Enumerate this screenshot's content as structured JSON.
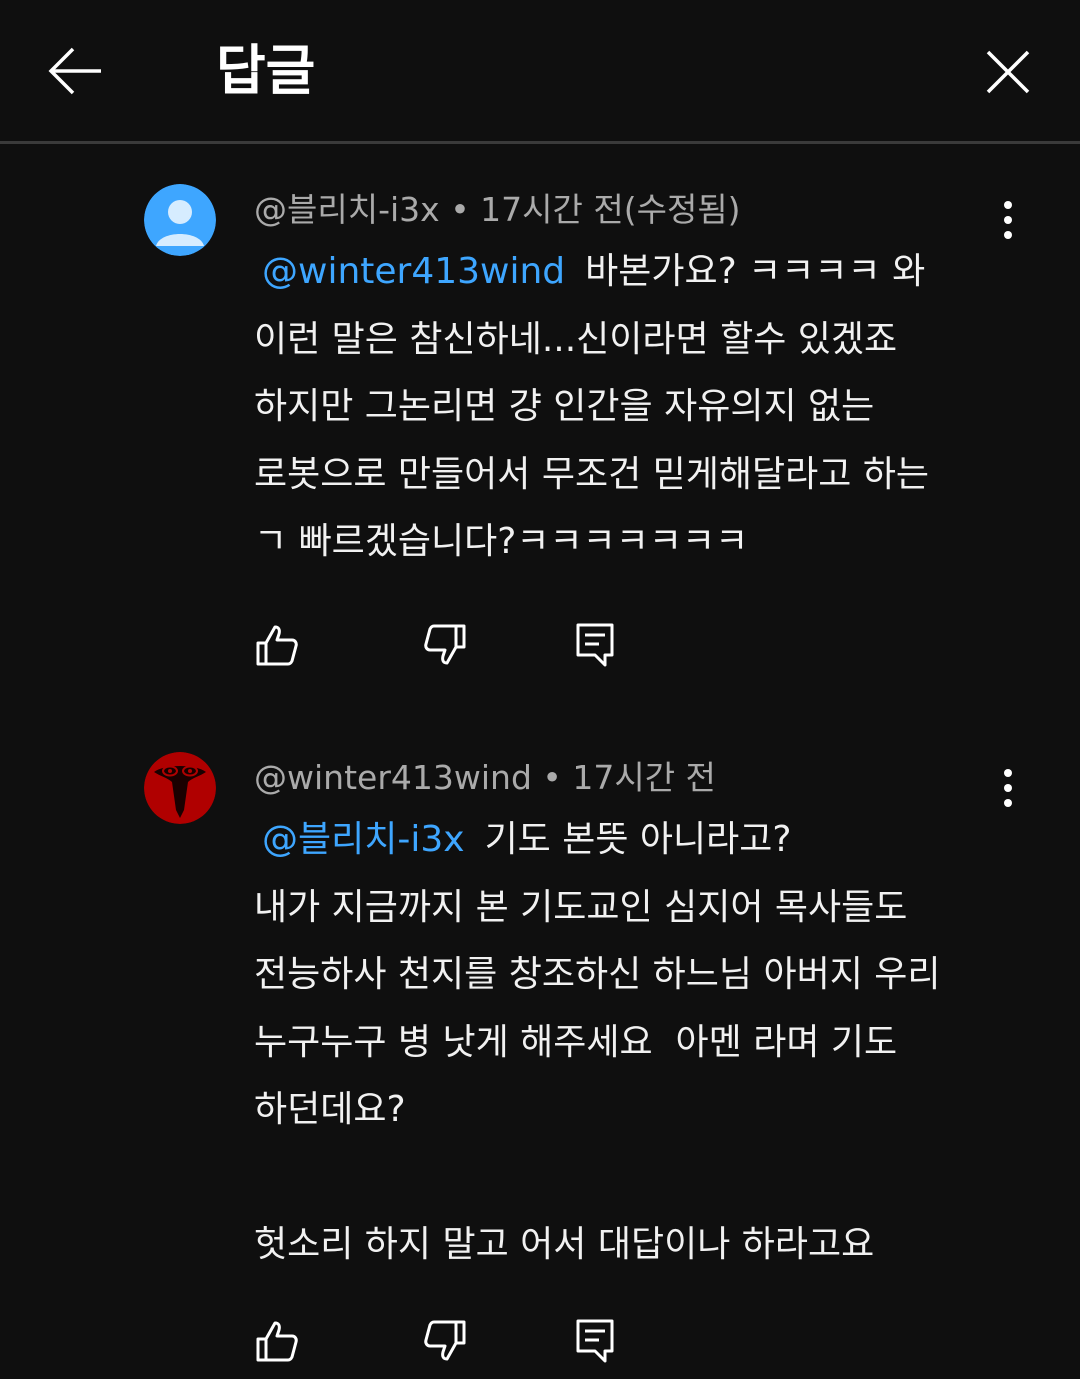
{
  "header": {
    "title": "답글",
    "back_icon": "arrow-left-icon",
    "close_icon": "close-icon"
  },
  "comments": [
    {
      "author": "@블리치-i3x",
      "separator": "•",
      "time": "17시간 전(수정됨)",
      "mention": "@winter413wind",
      "text_first": "바본가요? ㅋㅋㅋㅋ 와\n이런 말은 참신하네...신이라면 할수 있겠죠\n하지만 그논리면 걍 인간을 자유의지 없는\n로봇으로 만들어서 무조건 믿게해달라고 하는\nㄱ 빠르겠습니다?ㅋㅋㅋㅋㅋㅋㅋ",
      "avatar": "default-user-avatar",
      "avatar_color": "#3ea6ff"
    },
    {
      "author": "@winter413wind",
      "separator": "•",
      "time": "17시간 전",
      "mention": "@블리치-i3x",
      "text_first": "기도 본뜻 아니라고?\n내가 지금까지 본 기도교인 심지어 목사들도\n전능하사 천지를 창조하신 하느님 아버지 우리\n누구누구 병 낫게 해주세요  아멘 라며 기도\n하던데요?\n\n헛소리 하지 말고 어서 대답이나 하라고요",
      "avatar": "red-mask-avatar",
      "avatar_color": "#b00000"
    }
  ],
  "icons": {
    "like": "thumbs-up-icon",
    "dislike": "thumbs-down-icon",
    "reply": "reply-icon",
    "more": "more-vertical-icon"
  },
  "colors": {
    "background": "#0f0f0f",
    "text": "#f1f1f1",
    "meta": "#aaaaaa",
    "mention": "#3ea6ff"
  }
}
